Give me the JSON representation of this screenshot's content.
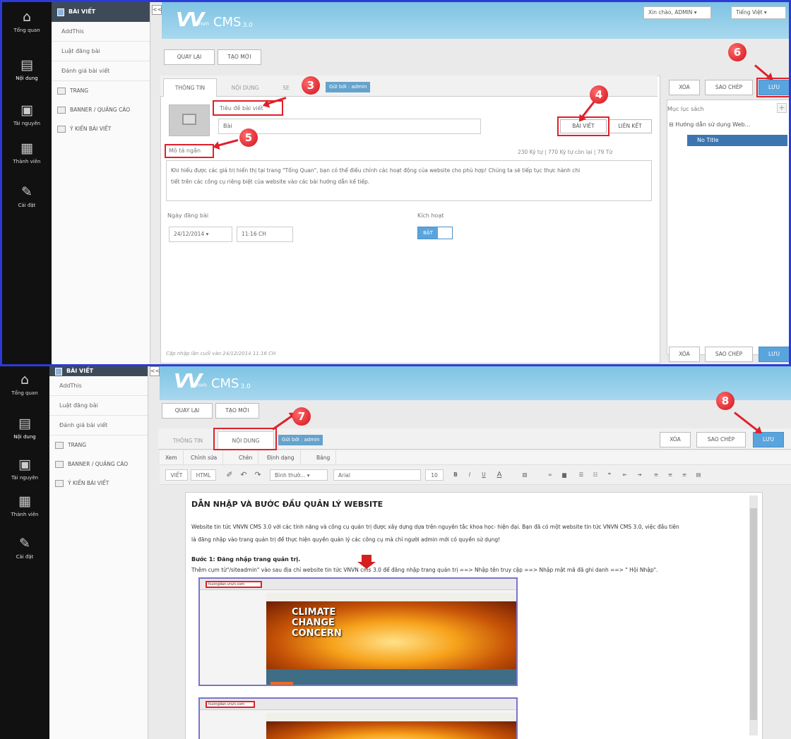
{
  "left_nav": [
    {
      "label": "Tổng quan",
      "icon": "home-icon"
    },
    {
      "label": "Nội dung",
      "icon": "document-icon"
    },
    {
      "label": "Tài nguyên",
      "icon": "folder-icon"
    },
    {
      "label": "Thành viên",
      "icon": "users-icon"
    },
    {
      "label": "Cài đặt",
      "icon": "wrench-icon"
    }
  ],
  "sidebar": {
    "header": "BÀI VIẾT",
    "subitems": [
      "AddThis",
      "Luật đăng bài",
      "Đánh giá bài viết"
    ],
    "sections": [
      "TRANG",
      "BANNER / QUẢNG CÁO",
      "Ý KIẾN BÀI VIẾT"
    ]
  },
  "collapse_label": "<<",
  "logo": {
    "brand": "vnvn",
    "cms": "CMS",
    "version": "3.0"
  },
  "top": {
    "greeting": "Xin chào, ADMIN ▾",
    "language": "Tiếng Việt ▾"
  },
  "actions": {
    "back": "QUAY LẠI",
    "new": "TẠO MỚI",
    "delete": "XÓA",
    "copy": "SAO CHÉP",
    "save": "LƯU"
  },
  "tabs": {
    "info": "THÔNG TIN",
    "content": "NỘI DUNG",
    "seo": "SE",
    "sent_by": "Gửi bởi : admin"
  },
  "form": {
    "title_placeholder": "Tiêu đề bài viết",
    "title_value": "Bài",
    "article_btn": "BÀI VIẾT",
    "link_btn": "LIÊN KẾT",
    "desc_label": "Mô tả ngắn",
    "counter": "230 Ký tự | 770 Ký tự còn lại | 79 Từ",
    "desc_line1": "Khi hiểu được các giá trị hiển thị tại trang \"Tổng Quan\", bạn có thể điều chỉnh các hoạt động của website cho phù hợp! Chúng ta sẽ tiếp tục thực hành chi",
    "desc_line2": "tiết trên các công cụ riêng biệt của website vào các bài hướng dẫn kế tiếp.",
    "date_label": "Ngày đăng bài",
    "date_value": "24/12/2014 ▾",
    "time_value": "11:16 CH",
    "active_label": "Kích hoạt",
    "toggle_on": "BẬT",
    "last_updated": "Cập nhập lần cuối vào 24/12/2014 11:16 CH"
  },
  "tree": {
    "title": "Mục lục sách",
    "plus": "+",
    "root": "⊟ Hướng dẫn sử dụng Web...",
    "selected": "No Title"
  },
  "annotations": [
    "3",
    "4",
    "5",
    "6",
    "7",
    "8"
  ],
  "editor_menu": [
    "Xem",
    "Chỉnh sửa",
    "Chèn",
    "Định dạng",
    "Bảng"
  ],
  "editor_toolbar": {
    "view": "VIẾT",
    "html": "HTML",
    "style": "Bình thườ... ▾",
    "font": "Arial",
    "size": "10",
    "bold": "B",
    "italic": "I",
    "underline": "U",
    "font_color": "A"
  },
  "doc": {
    "title": "DẪN NHẬP VÀ BƯỚC ĐẦU QUẢN LÝ WEBSITE",
    "p1": "Website tin tức VNVN CMS 3.0 với các tính năng và công cụ quản trị được xây dựng dựa trên nguyên tắc khoa học- hiện đại. Bạn đã có một website tin tức VNVN CMS 3.0, việc đầu tiên",
    "p2": "là đăng nhập vào trang quản trị để thực hiện quyền quản lý các công cụ mà chỉ người admin mới có quyền sử dụng!",
    "h1": "Bước 1: Đăng nhập trang quản trị.",
    "p3": "Thêm cụm từ\"/siteadmin\" vào sau địa chỉ website tin tức VNVN cms 3.0 để đăng nhập trang quản trị ==> Nhập tên truy cập ==> Nhập mật mã đã ghi danh ==> \" Hội Nhập\"."
  },
  "shot": {
    "url": "huongdan.vnvn.com",
    "climate": [
      "CLIMATE",
      "CHANGE",
      "CONCERN"
    ]
  }
}
